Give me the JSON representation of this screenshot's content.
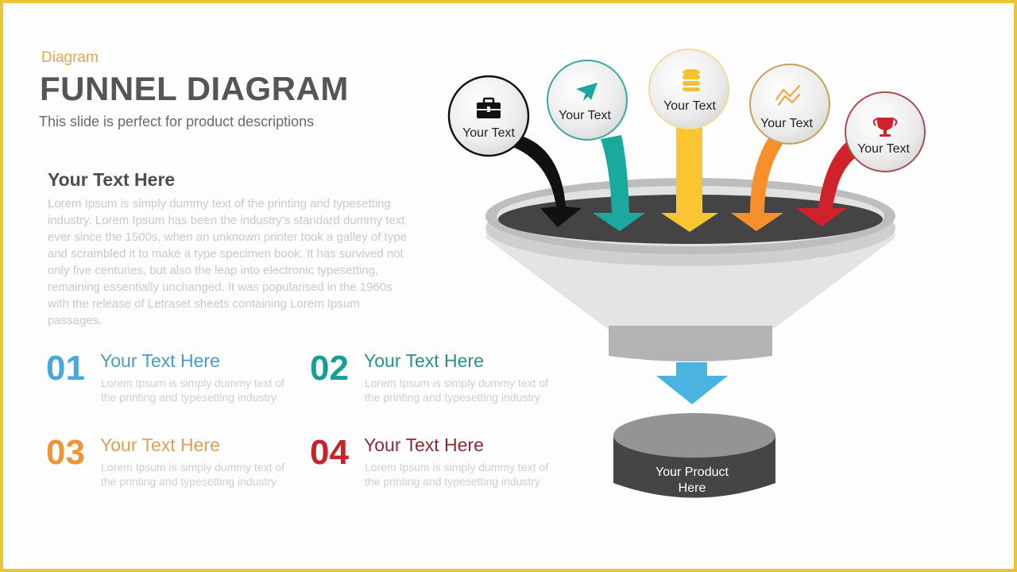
{
  "header": {
    "kicker": "Diagram",
    "title": "FUNNEL DIAGRAM",
    "subtitle": "This slide is perfect for product descriptions"
  },
  "intro": {
    "heading": "Your Text Here",
    "body": "Lorem Ipsum is simply dummy text of the printing and typesetting industry. Lorem Ipsum has been the industry's standard dummy text ever since the 1500s, when an unknown printer took a galley of type and scrambled it to make a type specimen book. It has survived not only five centuries, but also the leap into electronic typesetting, remaining essentially unchanged. It was popularised in the 1960s with the release of Letraset sheets containing Lorem Ipsum passages."
  },
  "items": [
    {
      "number": "01",
      "heading": "Your Text Here",
      "description": "Lorem Ipsum is simply dummy text of the printing and typesetting industry",
      "number_color": "#4aa8d8",
      "heading_color": "#4a9cc4"
    },
    {
      "number": "02",
      "heading": "Your Text Here",
      "description": "Lorem Ipsum is simply dummy text of the printing and typesetting industry",
      "number_color": "#1a9e94",
      "heading_color": "#2a8f88"
    },
    {
      "number": "03",
      "heading": "Your Text Here",
      "description": "Lorem Ipsum is simply dummy text of the printing and typesetting industry",
      "number_color": "#ee9436",
      "heading_color": "#d9a15a"
    },
    {
      "number": "04",
      "heading": "Your Text Here",
      "description": "Lorem Ipsum is simply dummy text of the printing and typesetting industry",
      "number_color": "#c4242c",
      "heading_color": "#8a2a35"
    }
  ],
  "funnel": {
    "inputs": [
      {
        "label": "Your Text",
        "icon": "briefcase-icon",
        "color": "#111111",
        "ring": "#111111"
      },
      {
        "label": "Your Text",
        "icon": "paper-plane-icon",
        "color": "#1aa99c",
        "ring": "#3aa8a0"
      },
      {
        "label": "Your Text",
        "icon": "database-coins-icon",
        "color": "#fbc531",
        "ring": "#f0dca0"
      },
      {
        "label": "Your Text",
        "icon": "trend-chart-icon",
        "color": "#f7902c",
        "ring": "#c8a060"
      },
      {
        "label": "Your Text",
        "icon": "trophy-icon",
        "color": "#d0222a",
        "ring": "#a85050"
      }
    ],
    "output_arrow_color": "#4ab3e0",
    "product_label_line1": "Your Product",
    "product_label_line2": "Here"
  }
}
